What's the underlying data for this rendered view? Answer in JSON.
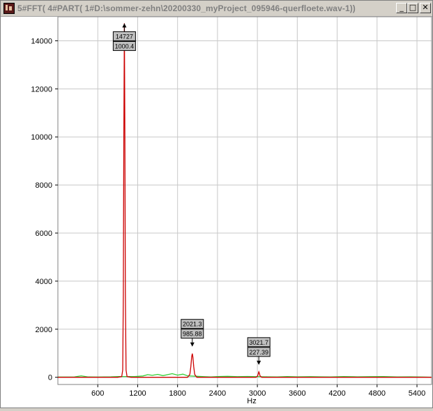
{
  "window": {
    "title": "5#FFT( 4#PART( 1#D:\\sommer-zehn\\20200330_myProject_095946-querfloete.wav-1))",
    "icon": "waveform-app-icon",
    "buttons": {
      "minimize": "_",
      "maximize": "□",
      "close": "✕"
    }
  },
  "colors": {
    "main_series": "#cc0000",
    "secondary_series": "#33cc33",
    "grid": "#c8c8c8",
    "callout_bg": "#c0c0c0"
  },
  "chart_data": {
    "type": "line",
    "title": "",
    "xlabel": "Hz",
    "ylabel": "",
    "xlim": [
      0,
      5620
    ],
    "ylim": [
      -300,
      15000
    ],
    "x_ticks": [
      600,
      1200,
      1800,
      2400,
      3000,
      3600,
      4200,
      4800,
      5400
    ],
    "y_ticks": [
      0,
      2000,
      4000,
      6000,
      8000,
      10000,
      12000,
      14000
    ],
    "grid": true,
    "series": [
      {
        "color": "#cc0000",
        "points": [
          [
            0,
            0
          ],
          [
            900,
            0
          ],
          [
            960,
            30
          ],
          [
            975,
            300
          ],
          [
            985,
            3500
          ],
          [
            992,
            10000
          ],
          [
            1000,
            14727
          ],
          [
            1008,
            10000
          ],
          [
            1015,
            3500
          ],
          [
            1025,
            300
          ],
          [
            1040,
            30
          ],
          [
            1100,
            0
          ],
          [
            1950,
            0
          ],
          [
            1985,
            120
          ],
          [
            2000,
            450
          ],
          [
            2012,
            850
          ],
          [
            2021,
            985
          ],
          [
            2030,
            850
          ],
          [
            2042,
            450
          ],
          [
            2057,
            120
          ],
          [
            2090,
            0
          ],
          [
            2980,
            0
          ],
          [
            3005,
            60
          ],
          [
            3015,
            170
          ],
          [
            3022,
            227
          ],
          [
            3030,
            170
          ],
          [
            3040,
            60
          ],
          [
            3065,
            0
          ],
          [
            5620,
            0
          ]
        ]
      },
      {
        "color": "#33cc33",
        "points": [
          [
            0,
            10
          ],
          [
            250,
            15
          ],
          [
            350,
            60
          ],
          [
            450,
            15
          ],
          [
            600,
            10
          ],
          [
            800,
            20
          ],
          [
            900,
            30
          ],
          [
            1150,
            30
          ],
          [
            1280,
            55
          ],
          [
            1350,
            110
          ],
          [
            1420,
            80
          ],
          [
            1500,
            120
          ],
          [
            1580,
            70
          ],
          [
            1650,
            110
          ],
          [
            1720,
            150
          ],
          [
            1800,
            90
          ],
          [
            1880,
            130
          ],
          [
            1950,
            60
          ],
          [
            2100,
            40
          ],
          [
            2200,
            25
          ],
          [
            2300,
            15
          ],
          [
            2400,
            30
          ],
          [
            2550,
            40
          ],
          [
            2700,
            25
          ],
          [
            2850,
            35
          ],
          [
            3150,
            20
          ],
          [
            3300,
            15
          ],
          [
            3450,
            30
          ],
          [
            3600,
            20
          ],
          [
            3800,
            25
          ],
          [
            3950,
            20
          ],
          [
            4100,
            15
          ],
          [
            4300,
            30
          ],
          [
            4500,
            20
          ],
          [
            4700,
            25
          ],
          [
            4900,
            30
          ],
          [
            5100,
            15
          ],
          [
            5300,
            20
          ],
          [
            5500,
            10
          ],
          [
            5620,
            5
          ]
        ]
      }
    ],
    "annotations": [
      {
        "freq": "14727",
        "value": "1000.4",
        "x": 1000,
        "y": 14727,
        "marker": "up-arrow"
      },
      {
        "freq": "2021.3",
        "value": "985.88",
        "x": 2021.3,
        "y": 985.88,
        "marker": "down-arrow"
      },
      {
        "freq": "3021.7",
        "value": "227.39",
        "x": 3021.7,
        "y": 227.39,
        "marker": "down-arrow"
      }
    ]
  }
}
